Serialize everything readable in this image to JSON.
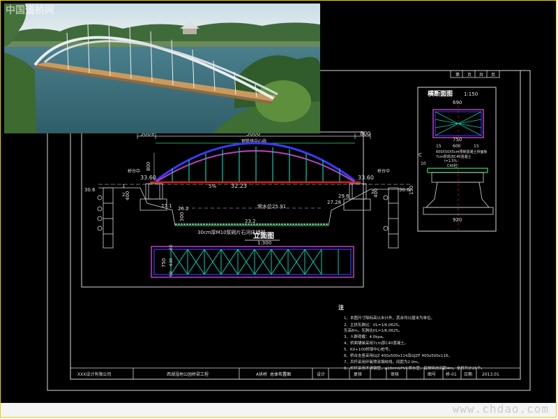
{
  "watermarks": {
    "top_left": "中国道桥网",
    "bottom_right": "www.chdao.com"
  },
  "colors": {
    "bg": "#000000",
    "frame": "#d8d8d8",
    "arch_top": "#3a3aff",
    "arch_bot": "#c040c0",
    "hanger": "#00d0b0",
    "deck": "#e02020",
    "dim": "#30e070",
    "text": "#ffffff",
    "yellow": "#e8e000"
  },
  "header_cells": [
    "第",
    "页",
    "共",
    "页"
  ],
  "elevation": {
    "dims_top": [
      "5000",
      "5000",
      "800"
    ],
    "dim_top_left": "3009",
    "arch_label": "钢管拱中心线",
    "deck_label": "5%",
    "deck_elev": "32.23",
    "left_abut_elev": "33.60",
    "right_abut_elev": "33.60",
    "left_pier_label": "桥台中",
    "right_pier_label": "桥台中",
    "water_label": "常水位25.91",
    "bed_elev": "23.2",
    "left_elevs": [
      "27.1",
      "26.2"
    ],
    "right_elevs": [
      "29.6",
      "27.28"
    ],
    "left_ground": "30.6",
    "right_ground": "30.6",
    "side_dims": [
      "1",
      "2",
      "400"
    ],
    "right_side_dims": [
      "2",
      "400"
    ],
    "dim_150": "150",
    "dim_800": "800",
    "dim_300": "300",
    "bed_note": "30cm厚M10浆砌片石河床铺砌",
    "view_title": "立面图",
    "scale": "1:300"
  },
  "plan": {
    "dims": [
      "60",
      "630",
      "60"
    ],
    "total": "750"
  },
  "section": {
    "title": "横断面图",
    "scale": "1:150",
    "top_width": "690",
    "width_750": "750",
    "dims": [
      "15",
      "600",
      "15"
    ],
    "note1": "600X50X5cm预制混凝土桥面板",
    "note2": "7cm厚现浇C40混凝土",
    "note3": "i=1.5%",
    "note4": "C40砼",
    "left_dim": "10",
    "bottom_width": "920",
    "pier_side": "C"
  },
  "notes": {
    "heading": "注",
    "lines": [
      "1、本图尺寸除标高以米计外，其余均以厘米为单位。",
      "2、主拱矢跨比：f/L=1/6.0625。",
      "   矢高8m，矢跨比f/L=1/6.0625。",
      "3、人群荷载：4.0kpa。",
      "4、桥面铺装采用7cm厚C40混凝土。",
      "5、K0+100桥墩中心桩号。",
      "6、桥台支座采用GJZ 400x500x114及GJZF 400x500x116。",
      "7、吊杆采用环氧喷涂钢绞线，间距为2.0m。",
      "8、栏杆采用不锈钢管，φ10cmUPVC泄水管，每侧纵向间距4m，全桥共计26个。"
    ]
  },
  "title_block": {
    "designer": "XXX设计有限公司",
    "project": "西湖湿地公园桥梁工程",
    "drawing": "总体布置图",
    "drawing_prefix": "A拱桥",
    "cells": [
      "设计",
      "复核",
      "审核"
    ],
    "num_label": "图号",
    "num": "桥-01",
    "date_label": "日期",
    "date": "2013.01"
  }
}
